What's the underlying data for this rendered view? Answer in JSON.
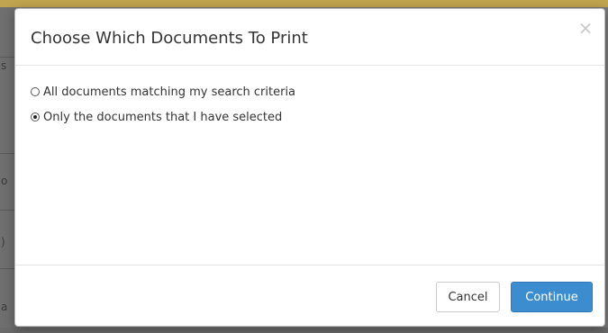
{
  "dialog": {
    "title": "Choose Which Documents To Print",
    "close_symbol": "×",
    "options": [
      {
        "label": "All documents matching my search criteria",
        "selected": false
      },
      {
        "label": "Only the documents that I have selected",
        "selected": true
      }
    ],
    "buttons": {
      "cancel": "Cancel",
      "continue": "Continue"
    }
  },
  "colors": {
    "primary_button": "#3c8dcf",
    "overlay": "#7a7a7a"
  },
  "background_fragments": [
    "s",
    "o",
    ")",
    "a"
  ]
}
